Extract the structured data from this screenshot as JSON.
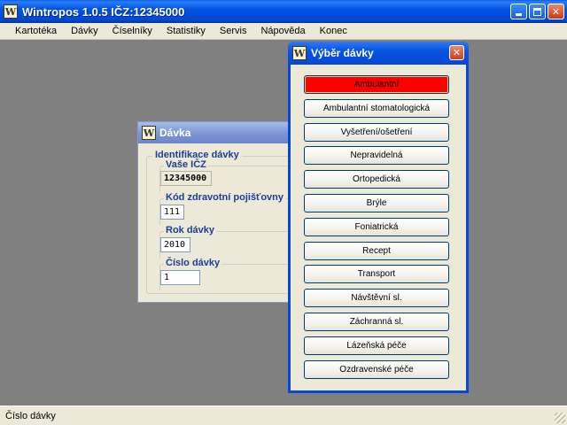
{
  "window": {
    "icon_letter": "W",
    "title": "Wintropos 1.0.5  IČZ:12345000",
    "minimize": "",
    "maximize": "",
    "close": "✕"
  },
  "menu": [
    "Kartotéka",
    "Dávky",
    "Číselníky",
    "Statistiky",
    "Servis",
    "Nápověda",
    "Konec"
  ],
  "davka_window": {
    "title": "Dávka",
    "group_title": "Identifikace dávky",
    "fields": [
      {
        "label": "Vaše IČZ",
        "value": "12345000"
      },
      {
        "label": "Kód zdravotní pojišťovny",
        "value": "111"
      },
      {
        "label": "Rok dávky",
        "value": "2010"
      },
      {
        "label": "Číslo dávky",
        "value": "1"
      }
    ]
  },
  "vyber_dialog": {
    "title": "Výběr dávky",
    "close": "✕",
    "selected_color": "#ff0000",
    "buttons": [
      "Ambulantní",
      "Ambulantní stomatologická",
      "Vyšetření/ošetření",
      "Nepravidelná",
      "Ortopedická",
      "Brýle",
      "Foniatrická",
      "Recept",
      "Transport",
      "Návštěvní sl.",
      "Záchranná sl.",
      "Lázeňská péče",
      "Ozdravenské péče"
    ]
  },
  "status": {
    "text": "Číslo dávky"
  }
}
